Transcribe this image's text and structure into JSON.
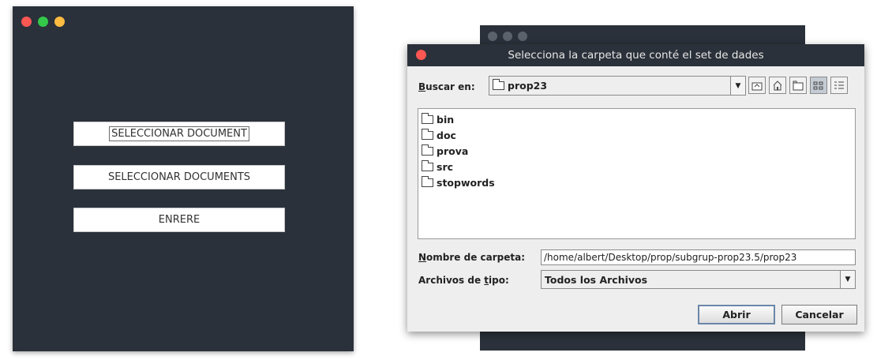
{
  "left_window": {
    "buttons": [
      {
        "label": "SELECCIONAR DOCUMENT"
      },
      {
        "label": "SELECCIONAR DOCUMENTS"
      },
      {
        "label": "ENRERE"
      }
    ]
  },
  "dialog": {
    "title": "Selecciona la carpeta que conté el set de dades",
    "look_in": {
      "label_underlined": "B",
      "label_rest": "uscar en:",
      "value": "prop23"
    },
    "files": [
      "bin",
      "doc",
      "prova",
      "src",
      "stopwords"
    ],
    "folder_name": {
      "label_underlined": "N",
      "label_rest": "ombre de carpeta:",
      "value": "/home/albert/Desktop/prop/subgrup-prop23.5/prop23"
    },
    "file_type": {
      "label_before": "Archivos de ",
      "label_underlined": "t",
      "label_after": "ipo:",
      "value": "Todos los Archivos"
    },
    "open_label": "Abrir",
    "cancel_label": "Cancelar"
  },
  "colors": {
    "window_bg": "#2b313a",
    "close": "#fc5753",
    "minimize": "#34c84a",
    "maximize": "#fdbc40"
  }
}
